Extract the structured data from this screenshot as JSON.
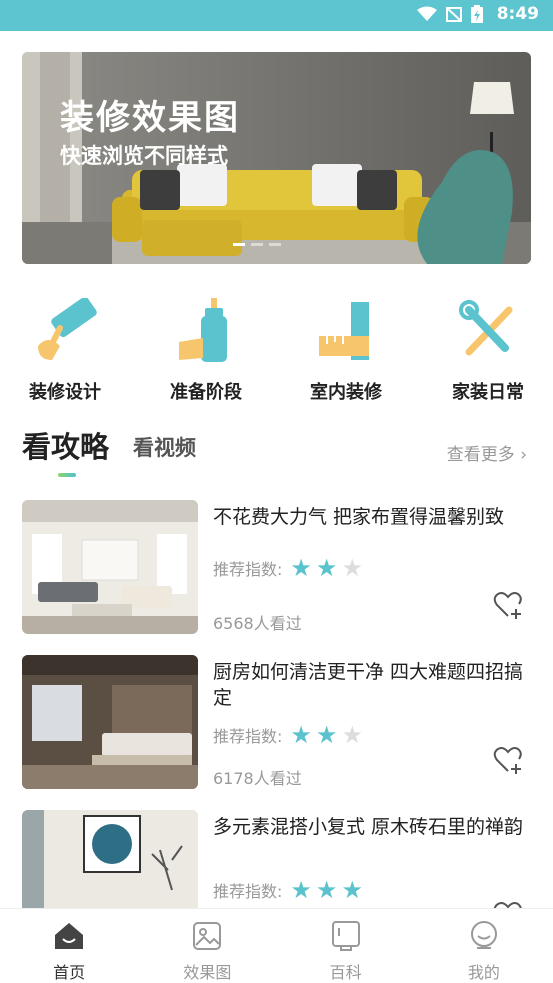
{
  "status_bar": {
    "time": "8:49",
    "icons": [
      "wifi-icon",
      "no-signal-icon",
      "battery-charging-icon"
    ]
  },
  "banner": {
    "title": "装修效果图",
    "subtitle": "快速浏览不同样式",
    "colors": {
      "sofa": "#e1c53a",
      "chair": "#4e8f88",
      "wall": "#6b6a66"
    }
  },
  "categories": [
    {
      "label": "装修设计",
      "icon": "paint-roller-icon"
    },
    {
      "label": "准备阶段",
      "icon": "paint-bottle-icon"
    },
    {
      "label": "室内装修",
      "icon": "ruler-icon"
    },
    {
      "label": "家装日常",
      "icon": "tools-icon"
    }
  ],
  "tabs": {
    "active": "看攻略",
    "inactive": "看视频",
    "more": "查看更多"
  },
  "articles": [
    {
      "title": "不花费大力气 把家布置得温馨别致",
      "rec_label": "推荐指数:",
      "rating": 2,
      "rating_max": 3,
      "views": "6568人看过"
    },
    {
      "title": "厨房如何清洁更干净 四大难题四招搞定",
      "rec_label": "推荐指数:",
      "rating": 2,
      "rating_max": 3,
      "views": "6178人看过"
    },
    {
      "title": "多元素混搭小复式 原木砖石里的禅韵",
      "rec_label": "推荐指数:",
      "rating": 3,
      "rating_max": 3,
      "views": ""
    }
  ],
  "bottom_nav": [
    {
      "label": "首页",
      "icon": "home-icon",
      "active": true
    },
    {
      "label": "效果图",
      "icon": "image-icon",
      "active": false
    },
    {
      "label": "百科",
      "icon": "book-icon",
      "active": false
    },
    {
      "label": "我的",
      "icon": "profile-icon",
      "active": false
    }
  ],
  "colors": {
    "accent": "#5bc3cd",
    "status_bar": "#5dc5cf",
    "icon_yellow": "#f7c56b"
  }
}
